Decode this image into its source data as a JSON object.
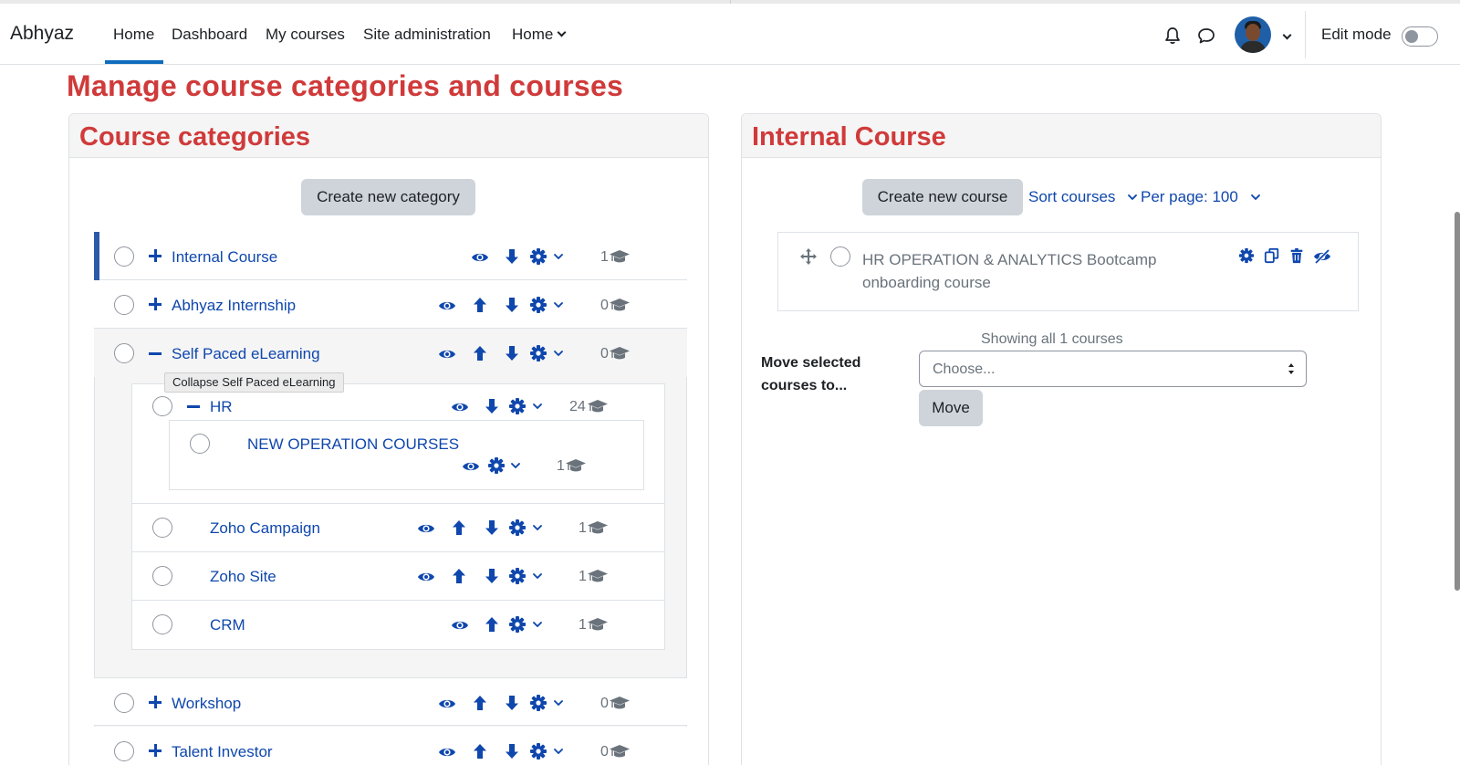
{
  "navbar": {
    "brand": "Abhyaz",
    "items": [
      "Home",
      "Dashboard",
      "My courses",
      "Site administration",
      "Home"
    ],
    "edit_mode_label": "Edit mode"
  },
  "page": {
    "title": "Manage course categories and courses"
  },
  "categories_panel": {
    "title": "Course categories",
    "create_button": "Create new category",
    "tooltip": "Collapse Self Paced eLearning",
    "categories": [
      {
        "name": "Internal Course",
        "count": "1"
      },
      {
        "name": "Abhyaz Internship",
        "count": "0"
      },
      {
        "name": "Self Paced eLearning",
        "count": "0"
      },
      {
        "name": "HR",
        "count": "24"
      },
      {
        "name": "NEW OPERATION COURSES",
        "count": "1"
      },
      {
        "name": "Zoho Campaign",
        "count": "1"
      },
      {
        "name": "Zoho Site",
        "count": "1"
      },
      {
        "name": "CRM",
        "count": "1"
      },
      {
        "name": "Workshop",
        "count": "0"
      },
      {
        "name": "Talent Investor",
        "count": "0"
      }
    ]
  },
  "courses_panel": {
    "title": "Internal Course",
    "create_button": "Create new course",
    "sort_label": "Sort courses",
    "per_page_label": "Per page: 100",
    "course_name": "HR OPERATION & ANALYTICS Bootcamp onboarding course",
    "showing": "Showing all 1 courses",
    "move_label": "Move selected courses to...",
    "select_placeholder": "Choose...",
    "move_button": "Move"
  },
  "colors": {
    "accent": "#0f47ad",
    "heading": "#d03a3a",
    "active": "#0f6cbf"
  }
}
